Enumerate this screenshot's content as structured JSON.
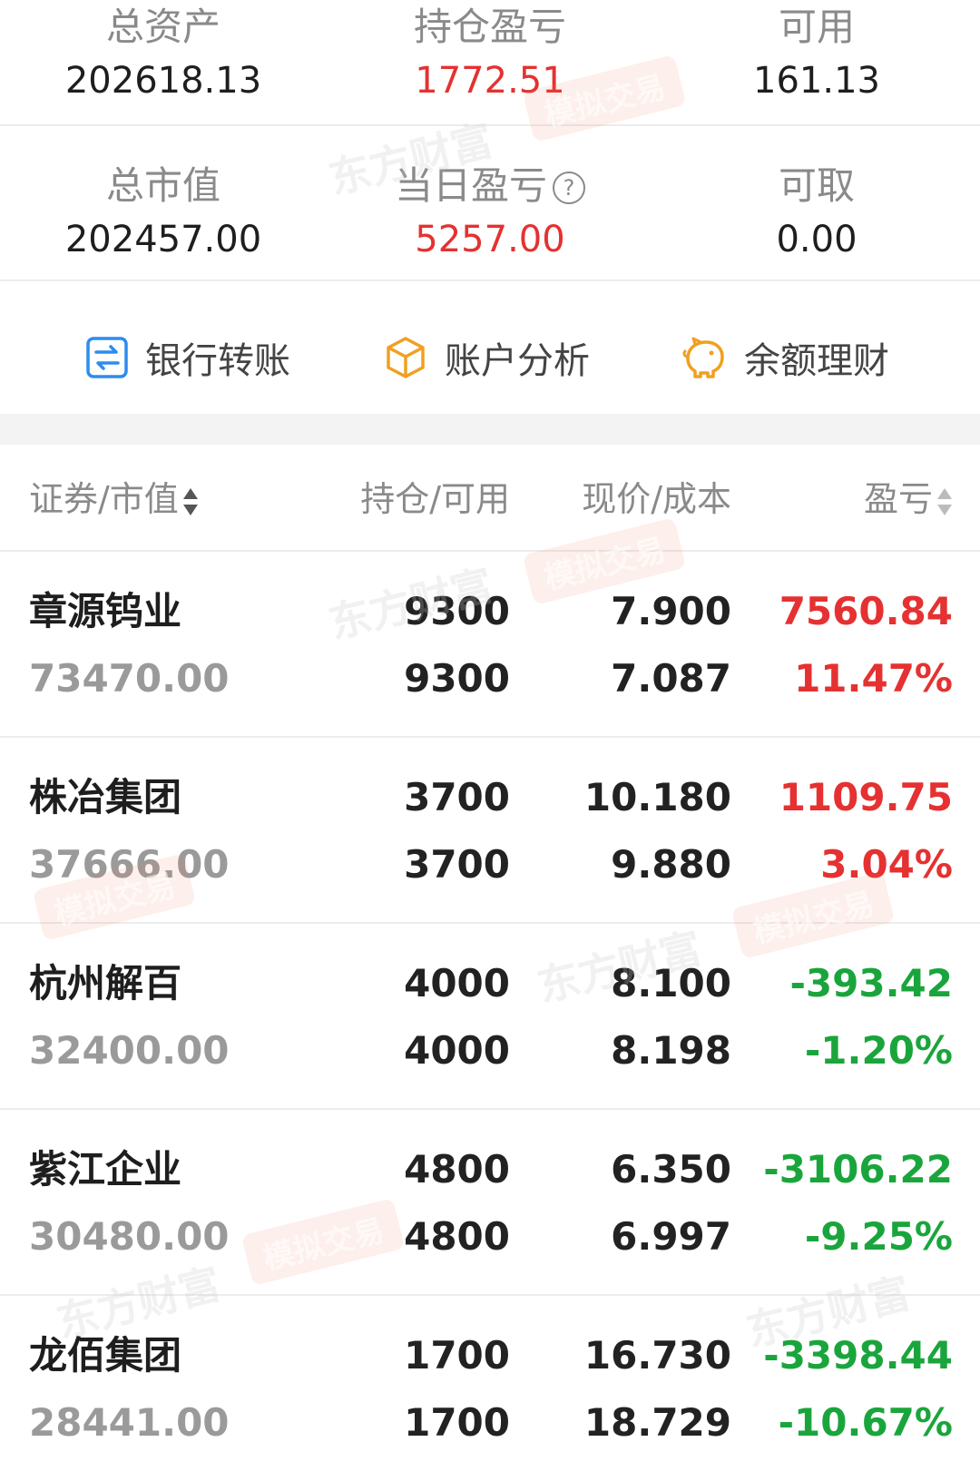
{
  "summary": {
    "total_assets_label": "总资产",
    "total_assets_value": "202618.13",
    "position_pl_label": "持仓盈亏",
    "position_pl_value": "1772.51",
    "available_label": "可用",
    "available_value": "161.13",
    "market_value_label": "总市值",
    "market_value_value": "202457.00",
    "daily_pl_label": "当日盈亏",
    "daily_pl_value": "5257.00",
    "withdrawable_label": "可取",
    "withdrawable_value": "0.00",
    "help_glyph": "?"
  },
  "actions": {
    "bank_transfer": "银行转账",
    "account_analysis": "账户分析",
    "balance_finance": "余额理财"
  },
  "table": {
    "col_security": "证券/市值",
    "col_position": "持仓/可用",
    "col_price": "现价/成本",
    "col_pl": "盈亏"
  },
  "stocks": [
    {
      "name": "章源钨业",
      "market_value": "73470.00",
      "position": "9300",
      "available": "9300",
      "price": "7.900",
      "cost": "7.087",
      "pl": "7560.84",
      "pl_pct": "11.47%",
      "trend": "up"
    },
    {
      "name": "株冶集团",
      "market_value": "37666.00",
      "position": "3700",
      "available": "3700",
      "price": "10.180",
      "cost": "9.880",
      "pl": "1109.75",
      "pl_pct": "3.04%",
      "trend": "up"
    },
    {
      "name": "杭州解百",
      "market_value": "32400.00",
      "position": "4000",
      "available": "4000",
      "price": "8.100",
      "cost": "8.198",
      "pl": "-393.42",
      "pl_pct": "-1.20%",
      "trend": "down"
    },
    {
      "name": "紫江企业",
      "market_value": "30480.00",
      "position": "4800",
      "available": "4800",
      "price": "6.350",
      "cost": "6.997",
      "pl": "-3106.22",
      "pl_pct": "-9.25%",
      "trend": "down"
    },
    {
      "name": "龙佰集团",
      "market_value": "28441.00",
      "position": "1700",
      "available": "1700",
      "price": "16.730",
      "cost": "18.729",
      "pl": "-3398.44",
      "pl_pct": "-10.67%",
      "trend": "down"
    }
  ],
  "watermarks": {
    "brand": "东方财富",
    "mode": "模拟交易"
  },
  "colors": {
    "profit": "#e53131",
    "loss": "#1aa53c",
    "icon_blue": "#2d8cf0",
    "icon_orange": "#f0a020"
  }
}
